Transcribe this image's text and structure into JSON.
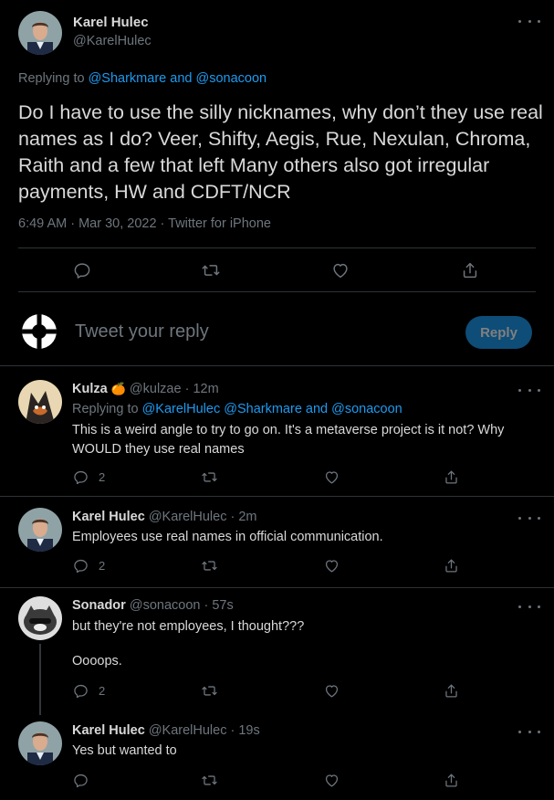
{
  "main_tweet": {
    "name": "Karel Hulec",
    "handle": "@KarelHulec",
    "replying_label": "Replying to",
    "replying_to_1": "@Sharkmare",
    "replying_and": "and",
    "replying_to_2": "@sonacoon",
    "text": "Do I have to use the silly nicknames, why don’t they use real names as I do? Veer, Shifty, Aegis, Rue, Nexulan, Chroma, Raith and a few that left Many others also got irregular payments, HW and CDFT/NCR",
    "timestamp": "6:49 AM · Mar 30, 2022 · Twitter for iPhone"
  },
  "reply_box": {
    "placeholder": "Tweet your reply",
    "button_label": "Reply"
  },
  "replies": [
    {
      "name": "Kulza",
      "emoji": "🍊",
      "handle": "@kulzae",
      "time": "· 12m",
      "replying_label": "Replying to",
      "replying_to": "@KarelHulec @Sharkmare and @sonacoon",
      "text": "This is a weird angle to try to go on. It's a metaverse project is it not? Why WOULD they use real names",
      "reply_count": "2"
    },
    {
      "name": "Karel Hulec",
      "handle": "@KarelHulec",
      "time": "· 2m",
      "text": "Employees use real names in official communication.",
      "reply_count": "2"
    },
    {
      "name": "Sonador",
      "handle": "@sonacoon",
      "time": "· 57s",
      "text_line1": "but they're not employees, I thought???",
      "text_line2": "Oooops.",
      "reply_count": "2"
    },
    {
      "name": "Karel Hulec",
      "handle": "@KarelHulec",
      "time": "· 19s",
      "text": "Yes but wanted to",
      "reply_count": ""
    }
  ],
  "icons": [
    "reply-icon",
    "retweet-icon",
    "like-icon",
    "share-icon",
    "more-icon"
  ],
  "colors": {
    "background": "#000000",
    "text": "#d9d9d9",
    "muted": "#6e767d",
    "link": "#1d9bf0",
    "divider": "#2f3336",
    "reply_button": "#0e4d77"
  }
}
